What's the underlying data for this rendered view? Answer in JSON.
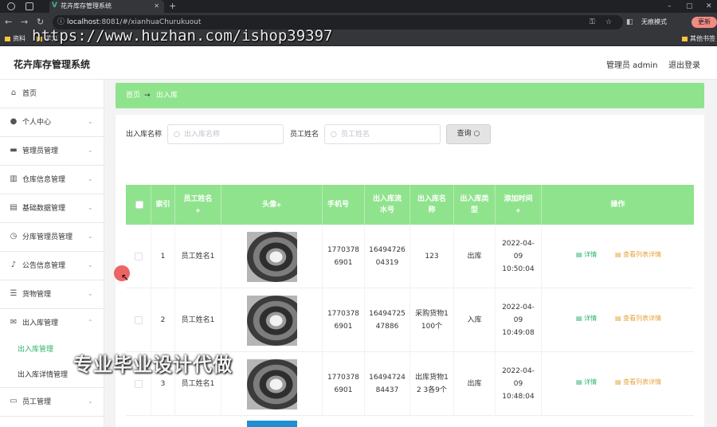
{
  "browser": {
    "tab_title": "花卉库存管理系统",
    "favicon": "V",
    "url_host": "localhost",
    "url_path": ":8081/#/xianhuaChurukuout",
    "incognito": "无痕模式",
    "update": "更新"
  },
  "bookmarks": [
    "资料",
    "学习",
    "其他书签"
  ],
  "watermarks": {
    "url": "https://www.huzhan.com/ishop39397",
    "text": "专业毕业设计代做"
  },
  "header": {
    "title": "花卉库存管理系统",
    "admin": "管理员 admin",
    "logout": "退出登录"
  },
  "sidebar": {
    "items": [
      {
        "label": "首页",
        "icon": "home-icon"
      },
      {
        "label": "个人中心",
        "icon": "user-icon"
      },
      {
        "label": "管理员管理",
        "icon": "monitor-icon"
      },
      {
        "label": "仓库信息管理",
        "icon": "chart-icon"
      },
      {
        "label": "基础数据管理",
        "icon": "document-icon"
      },
      {
        "label": "分库管理员管理",
        "icon": "clock-icon"
      },
      {
        "label": "公告信息管理",
        "icon": "microphone-icon"
      },
      {
        "label": "货物管理",
        "icon": "sliders-icon"
      },
      {
        "label": "出入库管理",
        "icon": "mail-icon"
      }
    ],
    "sub_items": [
      {
        "label": "出入库管理"
      },
      {
        "label": "出入库详情管理"
      }
    ],
    "last_item": {
      "label": "员工管理",
      "icon": "card-icon"
    }
  },
  "breadcrumb": {
    "home": "首页",
    "current": "出入库"
  },
  "search": {
    "label1": "出入库名称",
    "placeholder1": "出入库名称",
    "label2": "员工姓名",
    "placeholder2": "员工姓名",
    "button": "查询"
  },
  "table": {
    "headers": [
      "索引",
      "员工姓名",
      "头像",
      "手机号",
      "出入库流水号",
      "出入库名称",
      "出入库类型",
      "添加时间",
      "操作"
    ],
    "rows": [
      {
        "index": "1",
        "name": "员工姓名1",
        "phone": "17703786901",
        "serial": "1649472604319",
        "out_name": "123",
        "type": "出库",
        "time": "2022-04-09 10:50:04"
      },
      {
        "index": "2",
        "name": "员工姓名1",
        "phone": "17703786901",
        "serial": "1649472547886",
        "out_name": "采购货物1100个",
        "type": "入库",
        "time": "2022-04-09 10:49:08"
      },
      {
        "index": "3",
        "name": "员工姓名1",
        "phone": "17703786901",
        "serial": "1649472484437",
        "out_name": "出库货物1 2 3各9个",
        "type": "出库",
        "time": "2022-04-09 10:48:04"
      }
    ],
    "action_detail": "详情",
    "action_view": "查看列表详情"
  }
}
